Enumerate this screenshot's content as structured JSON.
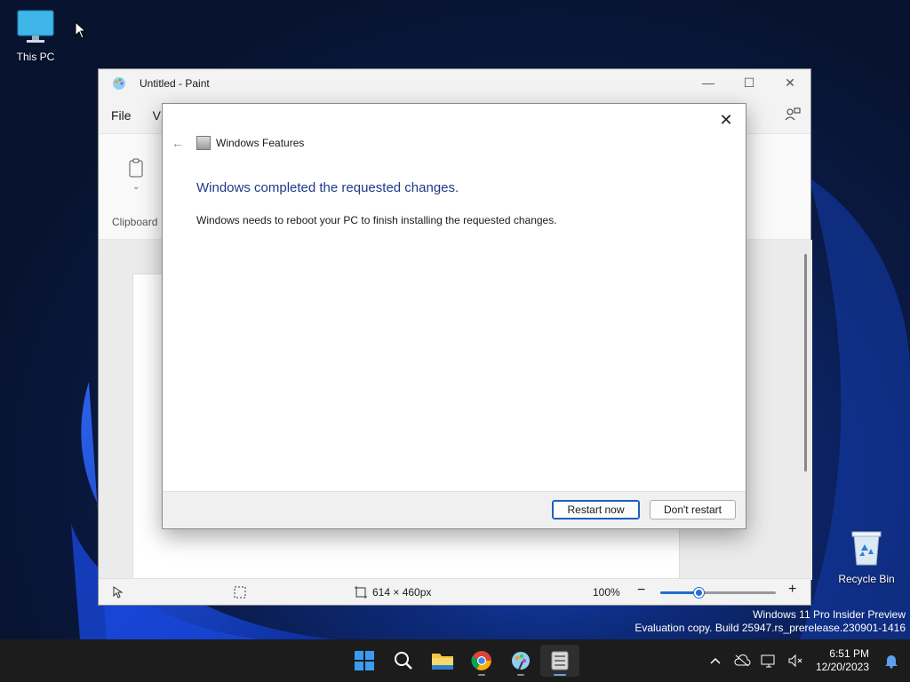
{
  "desktop": {
    "icons": [
      {
        "label": "This PC"
      },
      {
        "label": "Recycle Bin"
      }
    ],
    "watermark": {
      "line1": "Windows 11 Pro Insider Preview",
      "line2": "Evaluation copy. Build 25947.rs_prerelease.230901-1416"
    }
  },
  "paint": {
    "title": "Untitled - Paint",
    "menu": [
      "File",
      "V"
    ],
    "ribbon_group": "Clipboard",
    "status": {
      "canvas_size": "614 × 460px",
      "zoom": "100%",
      "zoom_fraction": 0.34
    }
  },
  "dialog": {
    "window_title": "Windows Features",
    "heading": "Windows completed the requested changes.",
    "body": "Windows needs to reboot your PC to finish installing the requested changes.",
    "restart_label": "Restart now",
    "dont_restart_label": "Don't restart"
  },
  "taskbar": {
    "apps": [
      "start-icon",
      "search-icon",
      "file-explorer-icon",
      "chrome-icon",
      "paint-icon",
      "windows-features-icon"
    ],
    "time": "6:51 PM",
    "date": "12/20/2023"
  },
  "colors": {
    "accent": "#1f5fbf",
    "heading": "#1e3a8a",
    "taskbar": "#1c1c1c"
  }
}
